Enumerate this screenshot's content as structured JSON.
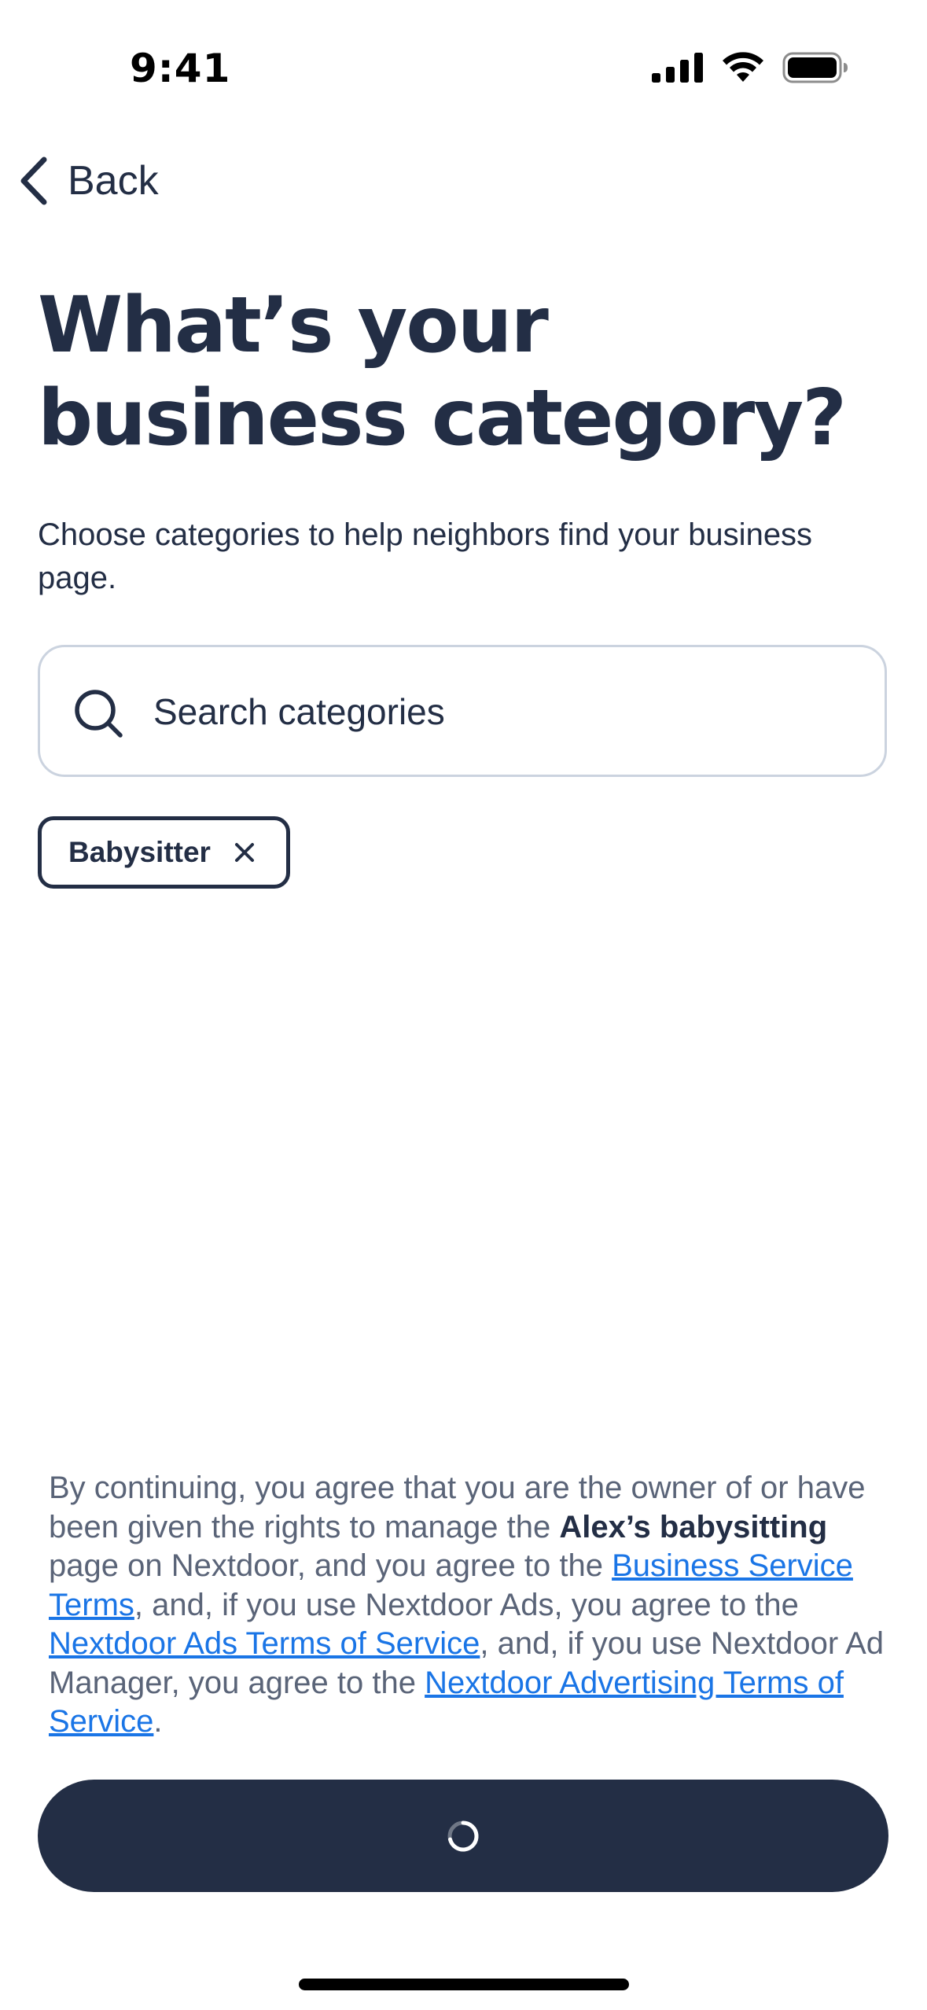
{
  "status_bar": {
    "time": "9:41",
    "icons": [
      "cellular-signal-icon",
      "wifi-icon",
      "battery-icon"
    ]
  },
  "nav": {
    "back_label": "Back",
    "back_icon": "chevron-left-icon"
  },
  "page": {
    "title_line1": "What’s your",
    "title_line2": "business category?",
    "subtitle": "Choose categories to help neighbors find your business page."
  },
  "search": {
    "placeholder": "Search categories",
    "value": "",
    "icon": "search-icon"
  },
  "selected_categories": [
    {
      "label": "Babysitter",
      "remove_icon": "close-icon"
    }
  ],
  "legal": {
    "part1": "By continuing, you agree that you are the owner of or have been given the rights to manage the ",
    "business_name": "Alex’s babysitting",
    "part2": " page on Nextdoor, and you agree to the ",
    "link1": "Business Service Terms",
    "part3": ", and, if you use Nextdoor Ads, you agree to the ",
    "link2": "Nextdoor Ads Terms of Service",
    "part4": ", and, if you use Nextdoor Ad Manager, you agree to the ",
    "link3": "Nextdoor Advertising Terms of Service",
    "part5": "."
  },
  "continue_button": {
    "state": "loading",
    "icon": "loading-spinner-icon"
  },
  "colors": {
    "primary": "#232e45",
    "link": "#1a75e6",
    "muted_text": "#5a6478",
    "border": "#cbd3df"
  }
}
